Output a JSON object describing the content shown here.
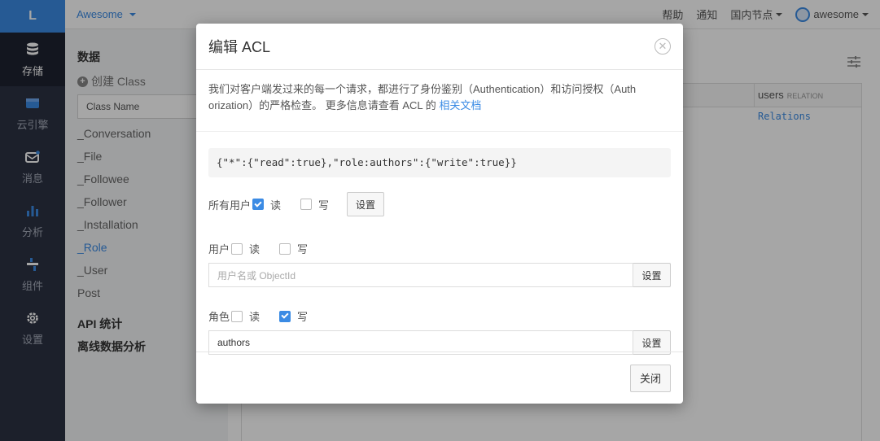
{
  "rail": {
    "logo": "L",
    "items": [
      {
        "label": "存储",
        "icon": "database-icon",
        "active": true
      },
      {
        "label": "云引擎",
        "icon": "cloud-engine-icon"
      },
      {
        "label": "消息",
        "icon": "message-icon"
      },
      {
        "label": "分析",
        "icon": "bar-chart-icon"
      },
      {
        "label": "组件",
        "icon": "components-icon"
      },
      {
        "label": "设置",
        "icon": "gear-icon"
      }
    ]
  },
  "topbar": {
    "app_name": "Awesome",
    "help": "帮助",
    "notify": "通知",
    "region": "国内节点",
    "user": "awesome"
  },
  "sidebar": {
    "section_data": "数据",
    "create_class": "创建 Class",
    "class_name_placeholder": "Class Name",
    "classes": [
      "_Conversation",
      "_File",
      "_Followee",
      "_Follower",
      "_Installation",
      "_Role",
      "_User",
      "Post"
    ],
    "active_class": "_Role",
    "api_stats": "API 统计",
    "offline_analysis": "离线数据分析"
  },
  "main": {
    "col_users": "users",
    "col_users_type": "RELATION",
    "relations_link": "Relations"
  },
  "modal": {
    "title": "编辑 ACL",
    "close_glyph": "✕",
    "desc_line1": "我们对客户端发过来的每一个请求，都进行了身份鉴别（Authentication）和访问授权（Auth",
    "desc_line2": "orization）的严格检查。 更多信息请查看 ACL 的 ",
    "desc_link": "相关文档",
    "acl_json": "{\"*\":{\"read\":true},\"role:authors\":{\"write\":true}}",
    "all_users_label": "所有用户",
    "read_label": "读",
    "write_label": "写",
    "set_label": "设置",
    "user_label": "用户",
    "user_placeholder": "用户名或 ObjectId",
    "role_label": "角色",
    "role_value": "authors",
    "close_button": "关闭"
  },
  "colors": {
    "accent": "#3b8be4",
    "rail_bg": "#2c3243"
  }
}
